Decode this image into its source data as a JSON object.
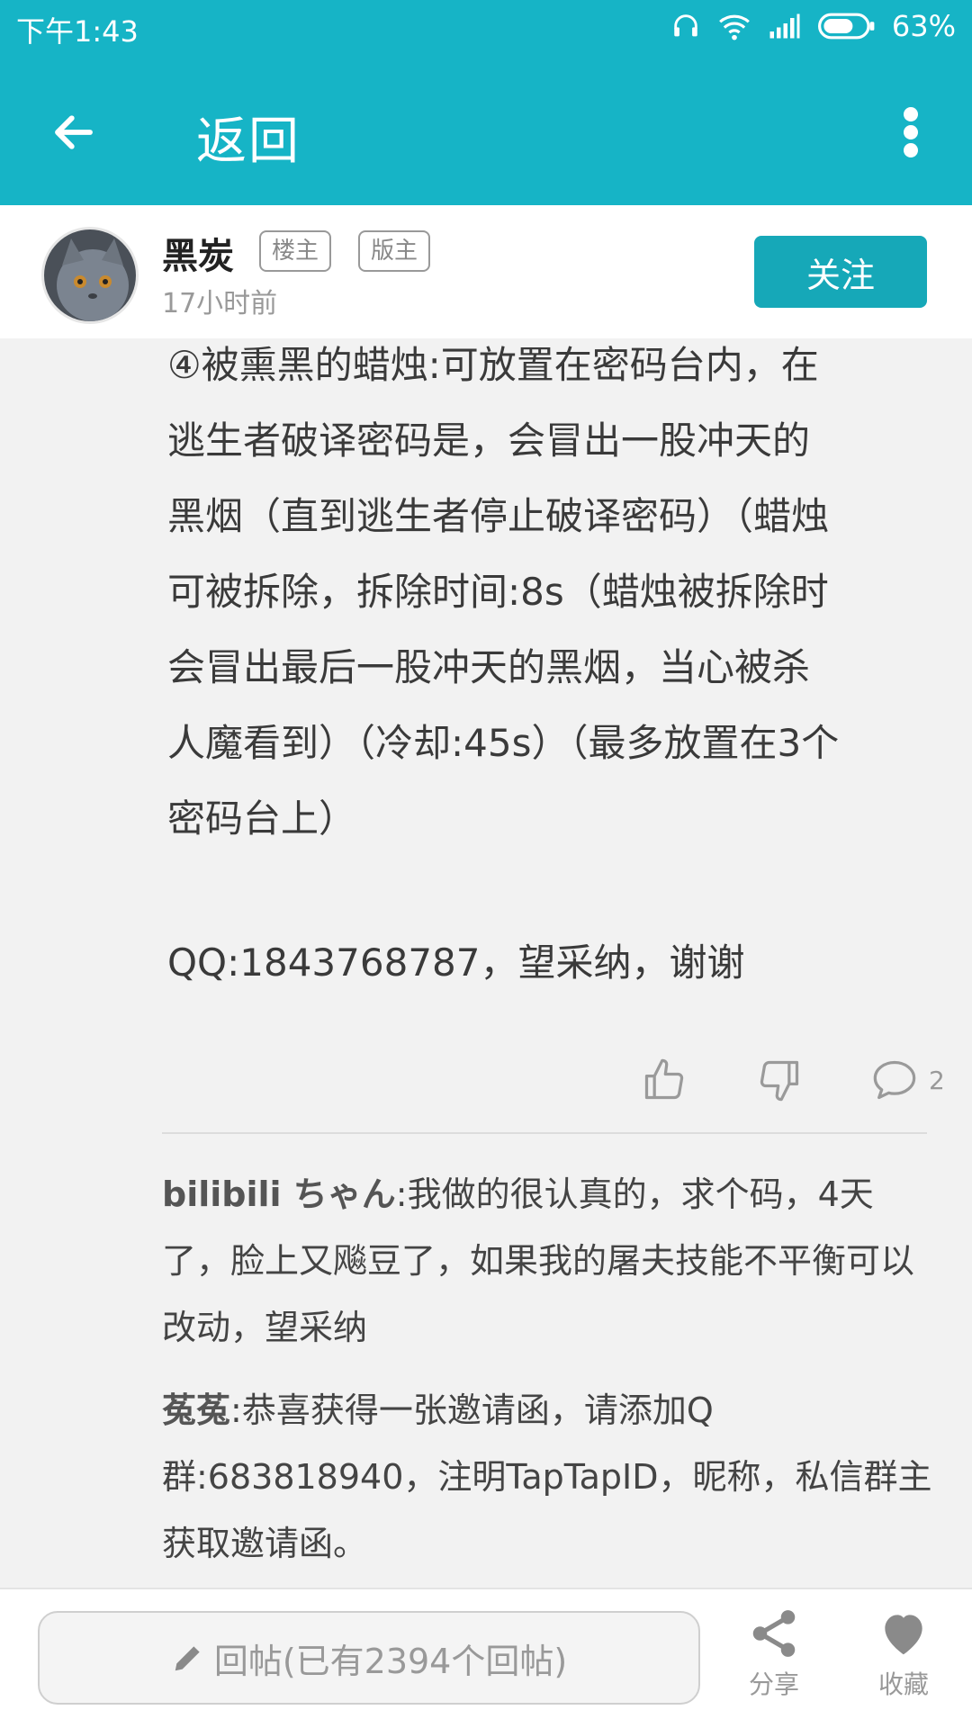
{
  "status_bar": {
    "time": "下午1:43",
    "battery": "63%"
  },
  "app_bar": {
    "title": "返回"
  },
  "author": {
    "name": "黑炭",
    "tags": [
      "楼主",
      "版主"
    ],
    "time": "17小时前",
    "follow_label": "关注"
  },
  "post": {
    "lines": [
      "④被熏黑的蜡烛:可放置在密码台内，在",
      "逃生者破译密码是，会冒出一股冲天的",
      "黑烟（直到逃生者停止破译密码）（蜡烛",
      "可被拆除，拆除时间:8s（蜡烛被拆除时",
      "会冒出最后一股冲天的黑烟，当心被杀",
      "人魔看到）（冷却:45s）（最多放置在3个",
      "密码台上）"
    ],
    "qq_line": "QQ:1843768787，望采纳，谢谢"
  },
  "actions": {
    "comment_count": "2"
  },
  "replies": [
    {
      "user": "bilibili ちゃん",
      "text": ":我做的很认真的，求个码，4天了，脸上又飚豆了，如果我的屠夫技能不平衡可以改动，望采纳"
    },
    {
      "user": "菟菟",
      "text": ":恭喜获得一张邀请函，请添加Q群:683818940，注明TapTapID，昵称，私信群主获取邀请函。"
    }
  ],
  "bottom_bar": {
    "reply_placeholder": "回帖(已有2394个回帖)",
    "share_label": "分享",
    "favorite_label": "收藏"
  },
  "colors": {
    "accent": "#16b4c6",
    "follow_button": "#16a8b8"
  }
}
